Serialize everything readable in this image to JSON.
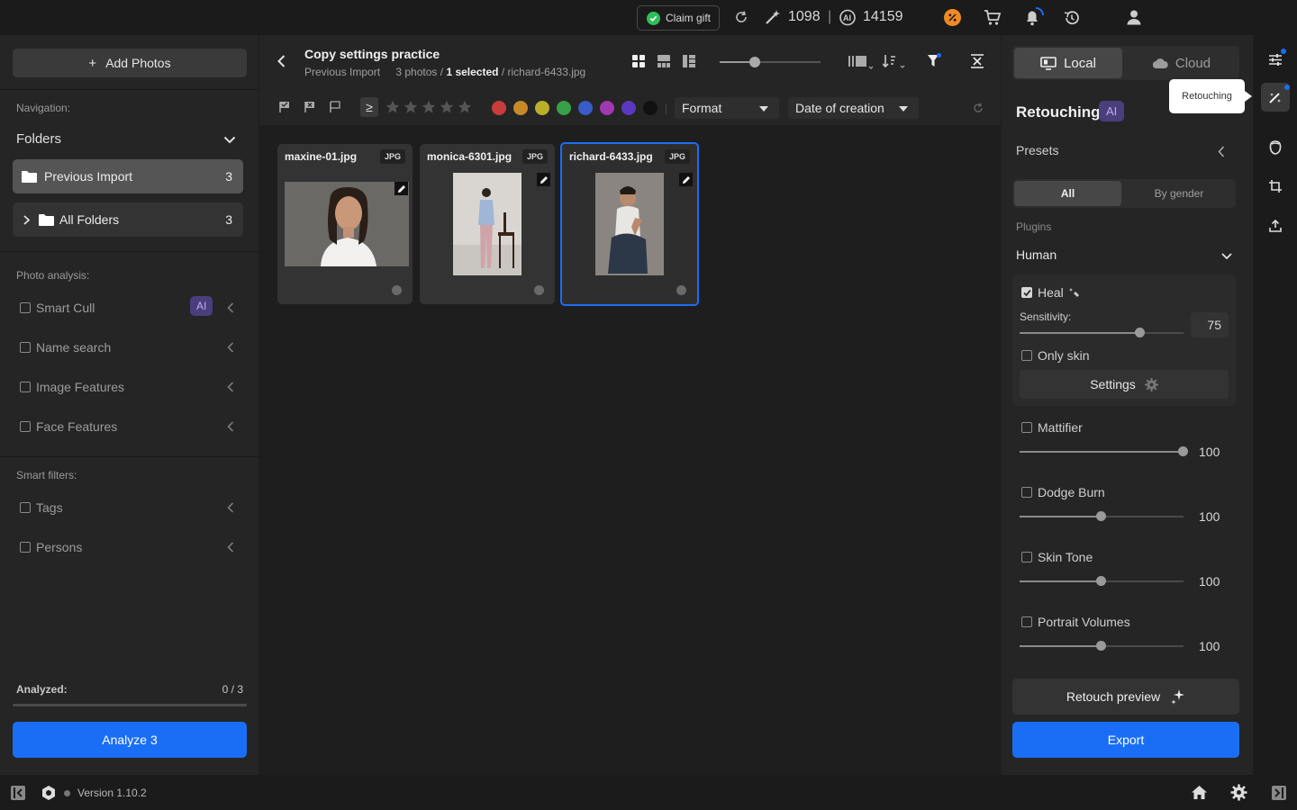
{
  "topbar": {
    "claim_gift": "Claim gift",
    "credits_retouch": "1098",
    "separator": "|",
    "credits_ai": "14159"
  },
  "left": {
    "add_photos": "Add Photos",
    "navigation_label": "Navigation:",
    "folders_label": "Folders",
    "folders": [
      {
        "name": "Previous Import",
        "count": "3"
      },
      {
        "name": "All Folders",
        "count": "3"
      }
    ],
    "photo_analysis_label": "Photo analysis:",
    "analysis_items": [
      "Smart Cull",
      "Name search",
      "Image Features",
      "Face Features"
    ],
    "ai_badge": "AI",
    "smart_filters_label": "Smart filters:",
    "filter_items": [
      "Tags",
      "Persons"
    ],
    "analyzed_label": "Analyzed:",
    "analyzed_value": "0 / 3",
    "analyzed_progress": 0,
    "analyze_button": "Analyze 3"
  },
  "center": {
    "title": "Copy settings practice",
    "breadcrumb_folder": "Previous Import",
    "photos_count": "3 photos /",
    "selected": "1 selected",
    "selected_file": "/ richard-6433.jpg",
    "format_dropdown": "Format",
    "sort_dropdown": "Date of creation",
    "rating_operator": "≥",
    "color_labels": [
      "#c83c3c",
      "#c88a28",
      "#b8b028",
      "#38a048",
      "#3a5cc8",
      "#a038b0",
      "#5a38c0",
      "#111111"
    ],
    "photos": [
      {
        "name": "maxine-01.jpg",
        "format": "JPG"
      },
      {
        "name": "monica-6301.jpg",
        "format": "JPG"
      },
      {
        "name": "richard-6433.jpg",
        "format": "JPG",
        "selected": true
      }
    ]
  },
  "right": {
    "tab_local": "Local",
    "tab_cloud": "Cloud",
    "section_title": "Retouching",
    "ai_badge": "AI",
    "presets_label": "Presets",
    "preset_all": "All",
    "preset_gender": "By gender",
    "plugins_label": "Plugins",
    "plugin_group": "Human",
    "heal": {
      "label": "Heal",
      "checked": true,
      "sensitivity_label": "Sensitivity:",
      "sensitivity": "75",
      "only_skin": "Only skin",
      "settings": "Settings"
    },
    "plugins": [
      {
        "name": "Mattifier",
        "value": "100",
        "level": 1.0
      },
      {
        "name": "Dodge Burn",
        "value": "100",
        "level": 0.5
      },
      {
        "name": "Skin Tone",
        "value": "100",
        "level": 0.5
      },
      {
        "name": "Portrait Volumes",
        "value": "100",
        "level": 0.5
      }
    ],
    "retouch_preview": "Retouch preview",
    "export": "Export"
  },
  "tooltip": "Retouching",
  "bottom": {
    "version": "Version 1.10.2"
  },
  "colors": {
    "accent": "#1a6ef5",
    "ai_badge": "#4a3e7d",
    "success": "#2fbf5a",
    "promo": "#f08a24"
  }
}
